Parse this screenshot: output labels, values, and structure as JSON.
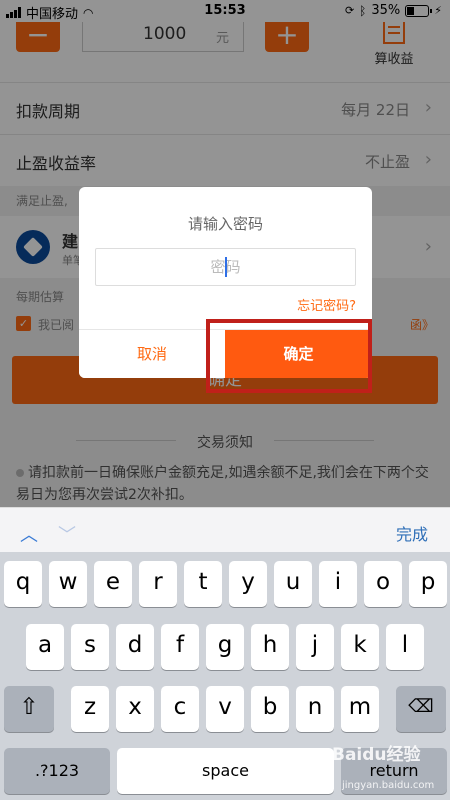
{
  "status_bar": {
    "carrier": "中国移动",
    "time": "15:53",
    "battery": "35%"
  },
  "amount": {
    "minus": "−",
    "plus": "+",
    "value": "1000",
    "unit": "元",
    "calc_label": "算收益"
  },
  "rows": [
    {
      "label": "扣款周期",
      "value": "每月 22日"
    },
    {
      "label": "止盈收益率",
      "value": "不止盈"
    }
  ],
  "hint": "满足止盈,",
  "bank": {
    "name": "建",
    "sub": "单笔"
  },
  "estimate": "每期估算",
  "agreement": {
    "prefix": "我已阅",
    "link": "函》"
  },
  "confirm_main": "确定",
  "notice": {
    "title": "交易须知",
    "body": "请扣款前一日确保账户金额充足,如遇余额不足,我们会在下两个交易日为您再次尝试2次补扣。"
  },
  "dialog": {
    "title": "请输入密码",
    "placeholder": "密码",
    "forgot": "忘记密码?",
    "cancel": "取消",
    "ok": "确定"
  },
  "keyboard": {
    "done": "完成",
    "row1": [
      "q",
      "w",
      "e",
      "r",
      "t",
      "y",
      "u",
      "i",
      "o",
      "p"
    ],
    "row2": [
      "a",
      "s",
      "d",
      "f",
      "g",
      "h",
      "j",
      "k",
      "l"
    ],
    "row3": [
      "z",
      "x",
      "c",
      "v",
      "b",
      "n",
      "m"
    ],
    "mode": ".?123",
    "space": "space",
    "return": "return",
    "shift_icon": "shift-icon",
    "delete_icon": "backspace-icon"
  },
  "watermark": {
    "brand": "Baidu经验",
    "url": "jingyan.baidu.com"
  },
  "colors": {
    "accent": "#ff6a13",
    "highlight": "#c0201a",
    "link_blue": "#2f6fb8"
  }
}
